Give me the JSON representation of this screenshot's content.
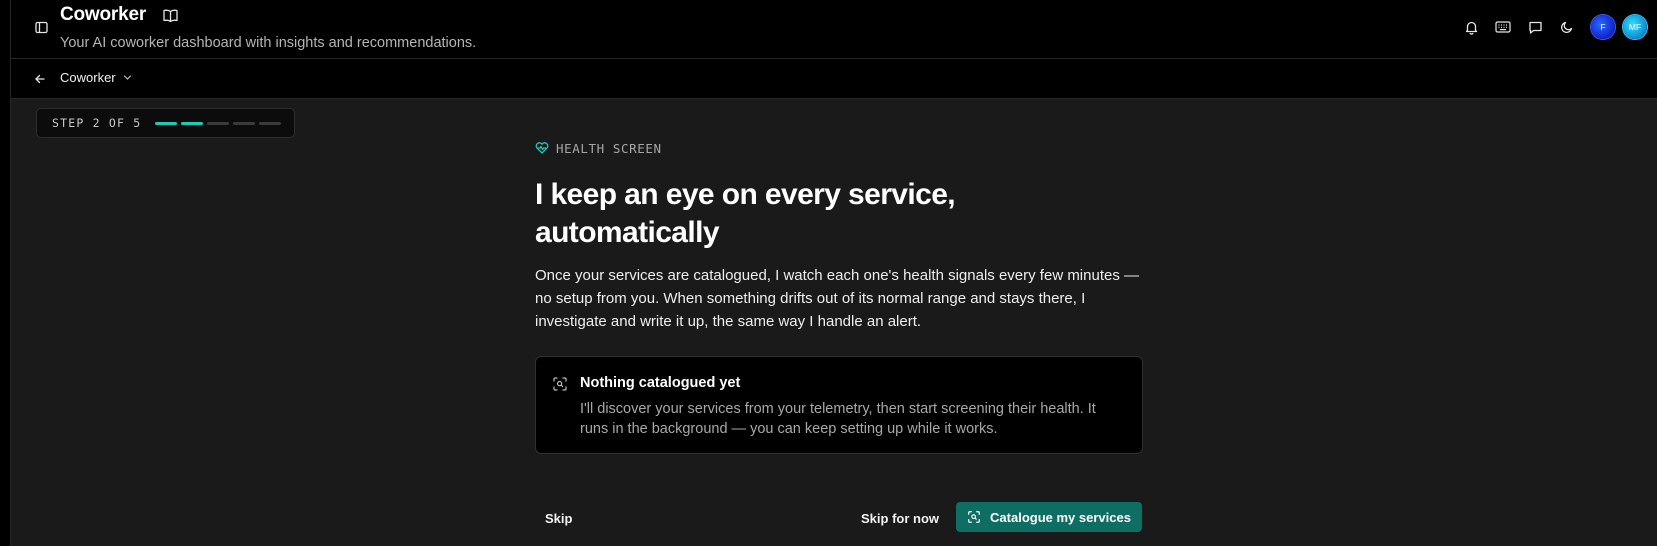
{
  "header": {
    "title": "Coworker",
    "subtitle": "Your AI coworker dashboard with insights and recommendations."
  },
  "icons": {
    "sidebar_toggle": "sidebar-panel-icon",
    "docs": "book-open-icon",
    "notifications": "bell-icon",
    "shortcuts": "keyboard-icon",
    "chat": "message-square-icon",
    "theme": "moon-icon",
    "back": "arrow-left-icon",
    "section": "heart-pulse-icon",
    "scan": "scan-icon"
  },
  "avatars": [
    {
      "initials": "F"
    },
    {
      "initials": "MF"
    }
  ],
  "breadcrumb": {
    "label": "Coworker"
  },
  "onboarding": {
    "step_label": "STEP 2 OF 5",
    "current_step": 2,
    "total_steps": 5,
    "eyebrow": "HEALTH SCREEN",
    "headline": "I keep an eye on every service, automatically",
    "body": "Once your services are catalogued, I watch each one's health signals every few minutes — no setup from you. When something drifts out of its normal range and stays there, I investigate and write it up, the same way I handle an alert.",
    "card": {
      "title": "Nothing catalogued yet",
      "description": "I'll discover your services from your telemetry, then start screening their health. It runs in the background — you can keep setting up while it works."
    },
    "actions": {
      "skip": "Skip",
      "skip_for_now": "Skip for now",
      "primary": "Catalogue my services"
    }
  },
  "colors": {
    "accent": "#1fc9b6",
    "primary_button": "#0f6e64",
    "page_bg": "#1a1a1a",
    "bar_bg": "#000000"
  }
}
